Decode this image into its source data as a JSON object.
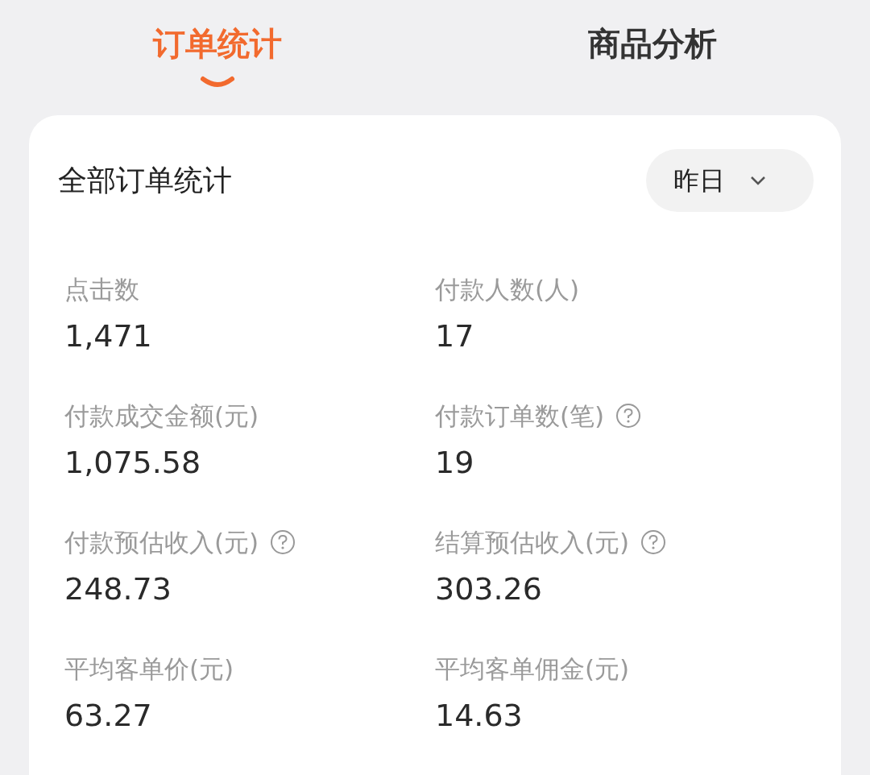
{
  "tabs": [
    {
      "label": "订单统计",
      "selected": true
    },
    {
      "label": "商品分析",
      "selected": false
    }
  ],
  "card": {
    "title": "全部订单统计",
    "period": {
      "value": "昨日"
    },
    "stats": [
      {
        "label": "点击数",
        "value": "1,471",
        "help": false
      },
      {
        "label": "付款人数(人)",
        "value": "17",
        "help": false
      },
      {
        "label": "付款成交金额(元)",
        "value": "1,075.58",
        "help": false
      },
      {
        "label": "付款订单数(笔)",
        "value": "19",
        "help": true
      },
      {
        "label": "付款预估收入(元)",
        "value": "248.73",
        "help": true
      },
      {
        "label": "结算预估收入(元)",
        "value": "303.26",
        "help": true
      },
      {
        "label": "平均客单价(元)",
        "value": "63.27",
        "help": false
      },
      {
        "label": "平均客单佣金(元)",
        "value": "14.63",
        "help": false
      }
    ]
  }
}
